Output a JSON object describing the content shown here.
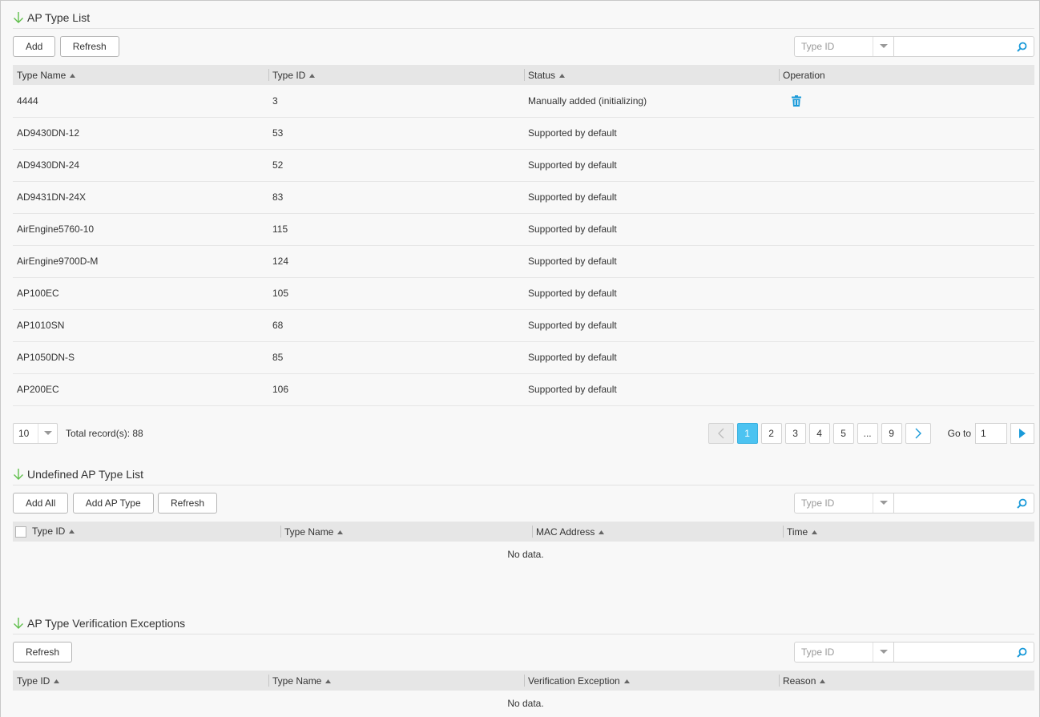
{
  "colors": {
    "accent": "#4cc3f1",
    "icon": "#1a9ad9",
    "title_arrow": "#5fbe4b"
  },
  "sections": {
    "ap_type_list": {
      "title": "AP Type List",
      "buttons": [
        "Add",
        "Refresh"
      ],
      "search": {
        "field": "Type ID",
        "placeholder": ""
      },
      "columns": [
        "Type Name",
        "Type ID",
        "Status",
        "Operation"
      ],
      "rows": [
        {
          "name": "4444",
          "id": "3",
          "status": "Manually added (initializing)",
          "deletable": true
        },
        {
          "name": "AD9430DN-12",
          "id": "53",
          "status": "Supported by default"
        },
        {
          "name": "AD9430DN-24",
          "id": "52",
          "status": "Supported by default"
        },
        {
          "name": "AD9431DN-24X",
          "id": "83",
          "status": "Supported by default"
        },
        {
          "name": "AirEngine5760-10",
          "id": "115",
          "status": "Supported by default"
        },
        {
          "name": "AirEngine9700D-M",
          "id": "124",
          "status": "Supported by default"
        },
        {
          "name": "AP100EC",
          "id": "105",
          "status": "Supported by default"
        },
        {
          "name": "AP1010SN",
          "id": "68",
          "status": "Supported by default"
        },
        {
          "name": "AP1050DN-S",
          "id": "85",
          "status": "Supported by default"
        },
        {
          "name": "AP200EC",
          "id": "106",
          "status": "Supported by default"
        }
      ],
      "pager": {
        "page_size": "10",
        "total": "Total record(s): 88",
        "pages": [
          "1",
          "2",
          "3",
          "4",
          "5",
          "...",
          "9"
        ],
        "active": "1",
        "goto_label": "Go to",
        "goto_value": "1"
      }
    },
    "undefined_list": {
      "title": "Undefined AP Type List",
      "buttons": [
        "Add All",
        "Add AP Type",
        "Refresh"
      ],
      "search": {
        "field": "Type ID",
        "placeholder": ""
      },
      "columns": [
        "Type ID",
        "Type Name",
        "MAC Address",
        "Time"
      ],
      "empty": "No data."
    },
    "verification": {
      "title": "AP Type Verification Exceptions",
      "buttons": [
        "Refresh"
      ],
      "search": {
        "field": "Type ID",
        "placeholder": ""
      },
      "columns": [
        "Type ID",
        "Type Name",
        "Verification Exception",
        "Reason"
      ],
      "empty": "No data."
    }
  }
}
